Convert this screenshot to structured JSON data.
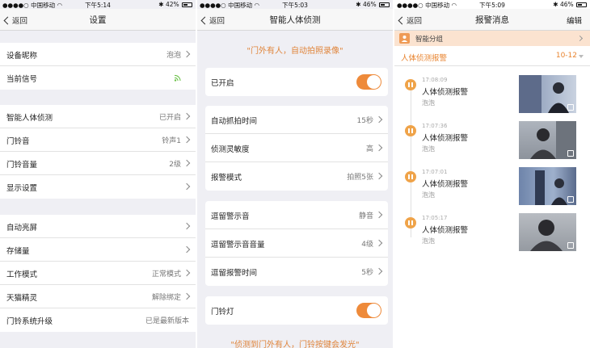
{
  "screen1": {
    "status": {
      "carrier": "中国移动",
      "time": "下午5:14",
      "battery": "42%",
      "battery_level": 0.42
    },
    "nav": {
      "back": "返回",
      "title": "设置"
    },
    "group1": [
      {
        "label": "设备昵称",
        "value": "泡泡",
        "arrow": true
      },
      {
        "label": "当前信号",
        "value": "",
        "icon": "wifi-signal-icon"
      }
    ],
    "group2": [
      {
        "label": "智能人体侦测",
        "value": "已开启"
      },
      {
        "label": "门铃音",
        "value": "铃声1"
      },
      {
        "label": "门铃音量",
        "value": "2级"
      },
      {
        "label": "显示设置",
        "value": ""
      }
    ],
    "group3": [
      {
        "label": "自动亮屏",
        "value": ""
      },
      {
        "label": "存储量",
        "value": ""
      },
      {
        "label": "工作模式",
        "value": "正常模式"
      },
      {
        "label": "天猫精灵",
        "value": "解除绑定"
      },
      {
        "label": "门铃系统升级",
        "value": "已是最新版本"
      }
    ]
  },
  "screen2": {
    "status": {
      "carrier": "中国移动",
      "time": "下午5:03",
      "battery": "46%",
      "battery_level": 0.46
    },
    "nav": {
      "back": "返回",
      "title": "智能人体侦测"
    },
    "top_quote": "\"门外有人，自动拍照录像\"",
    "enabled_label": "已开启",
    "enabled_on": true,
    "capture_rows": [
      {
        "label": "自动抓拍时间",
        "value": "15秒"
      },
      {
        "label": "侦测灵敏度",
        "value": "高"
      },
      {
        "label": "报警模式",
        "value": "拍照5张"
      }
    ],
    "linger_rows": [
      {
        "label": "逗留警示音",
        "value": "静音"
      },
      {
        "label": "逗留警示音音量",
        "value": "4级"
      },
      {
        "label": "逗留报警时间",
        "value": "5秒"
      }
    ],
    "doorbell_light_label": "门铃灯",
    "doorbell_light_on": true,
    "bottom_quote": "\"侦测到门外有人，门铃按键会发光\""
  },
  "screen3": {
    "status": {
      "carrier": "中国移动",
      "time": "下午5:09",
      "battery": "46%",
      "battery_level": 0.46
    },
    "nav": {
      "back": "返回",
      "title": "报警消息",
      "right": "编辑"
    },
    "smart_group": "智能分组",
    "filter": {
      "type": "人体侦测报警",
      "date": "10-12"
    },
    "events": [
      {
        "time": "17:08:09",
        "title": "人体侦测报警",
        "device": "泡泡"
      },
      {
        "time": "17:07:36",
        "title": "人体侦测报警",
        "device": "泡泡"
      },
      {
        "time": "17:07:01",
        "title": "人体侦测报警",
        "device": "泡泡"
      },
      {
        "time": "17:05:17",
        "title": "人体侦测报警",
        "device": "泡泡"
      }
    ]
  },
  "colors": {
    "accent": "#ee8a3a",
    "background": "#efeff4"
  }
}
